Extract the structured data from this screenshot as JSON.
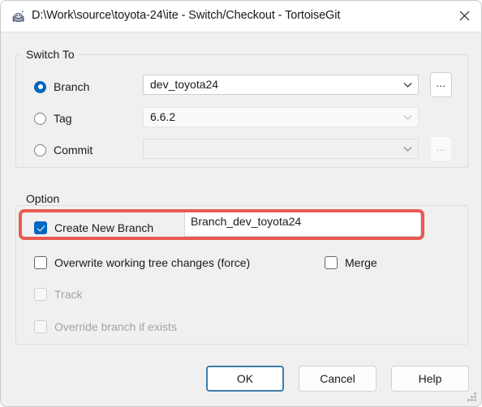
{
  "window": {
    "title": "D:\\Work\\source\\toyota-24\\ite - Switch/Checkout - TortoiseGit",
    "icon": "tortoisegit-turtle-icon",
    "close_label": "close-icon"
  },
  "switch_to": {
    "group_label": "Switch To",
    "options": [
      {
        "id": "branch",
        "label": "Branch",
        "selected": true,
        "value": "dev_toyota24",
        "has_browse": true,
        "browse_label": "...",
        "browse_enabled": true
      },
      {
        "id": "tag",
        "label": "Tag",
        "selected": false,
        "value": "6.6.2",
        "has_browse": false,
        "browse_label": "",
        "browse_enabled": false
      },
      {
        "id": "commit",
        "label": "Commit",
        "selected": false,
        "value": "",
        "has_browse": true,
        "browse_label": "...",
        "browse_enabled": false
      }
    ]
  },
  "option": {
    "group_label": "Option",
    "create_new_branch": {
      "label": "Create New Branch",
      "checked": true,
      "enabled": true,
      "input_value": "Branch_dev_toyota24",
      "input_placeholder": ""
    },
    "overwrite": {
      "label": "Overwrite working tree changes (force)",
      "checked": false,
      "enabled": true
    },
    "merge": {
      "label": "Merge",
      "checked": false,
      "enabled": true
    },
    "track": {
      "label": "Track",
      "checked": false,
      "enabled": false
    },
    "override": {
      "label": "Override branch if exists",
      "checked": false,
      "enabled": false
    }
  },
  "buttons": {
    "ok": "OK",
    "cancel": "Cancel",
    "help": "Help"
  },
  "highlight": {
    "color": "#ea5a51",
    "target": "create-new-branch-row"
  },
  "colors": {
    "accent": "#0067c0",
    "dialog_background": "#f0f0f0",
    "titlebar_background": "#ffffff",
    "default_button_border": "#3d7fab"
  }
}
